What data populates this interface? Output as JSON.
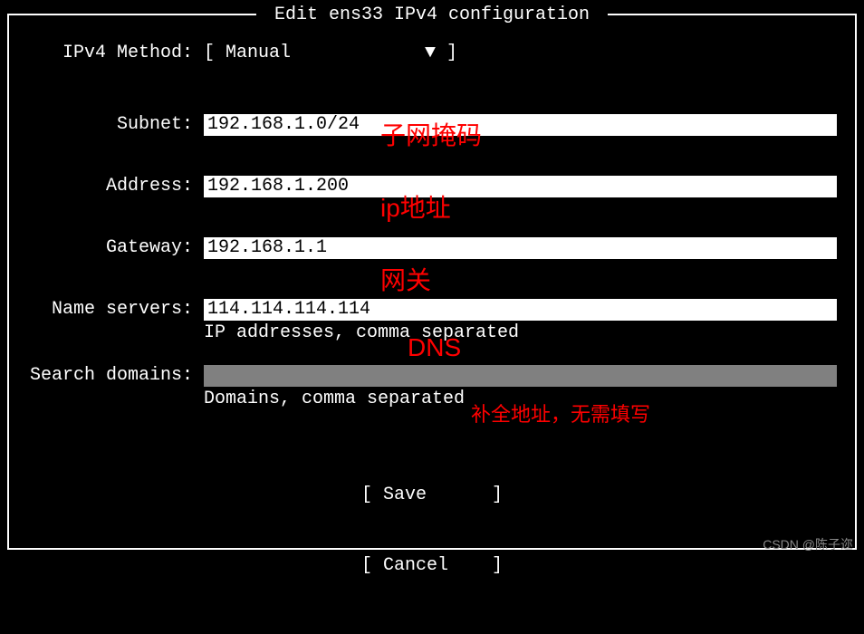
{
  "title": " Edit ens33 IPv4 configuration ",
  "method": {
    "label": "IPv4 Method:",
    "value": "Manual",
    "bracket_open": "[ ",
    "bracket_close": " ]",
    "arrow": "▼"
  },
  "fields": {
    "subnet": {
      "label": "Subnet:",
      "value": "192.168.1.0/24"
    },
    "address": {
      "label": "Address:",
      "value": "192.168.1.200"
    },
    "gateway": {
      "label": "Gateway:",
      "value": "192.168.1.1"
    },
    "nameservers": {
      "label": "Name servers:",
      "value": "114.114.114.114",
      "hint": "IP addresses, comma separated"
    },
    "searchdomains": {
      "label": "Search domains:",
      "value": "",
      "hint": "Domains, comma separated"
    }
  },
  "buttons": {
    "save": "[ Save      ]",
    "cancel": "[ Cancel    ]"
  },
  "annotations": {
    "subnet": "子网掩码",
    "address": "ip地址",
    "gateway": "网关",
    "dns": "DNS",
    "searchdomains": "补全地址，无需填写"
  },
  "watermark": "CSDN @陈子迩"
}
